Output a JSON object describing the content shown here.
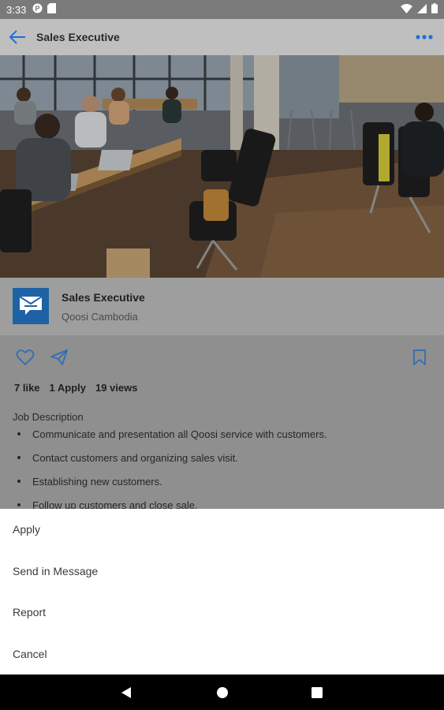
{
  "status_bar": {
    "time": "3:33",
    "icons": [
      "pinterest-icon",
      "sd-card-icon",
      "wifi-icon",
      "signal-icon",
      "battery-icon"
    ]
  },
  "app_bar": {
    "title": "Sales Executive",
    "back_icon": "back-arrow-icon",
    "more_icon": "more-dots-icon",
    "accent": "#1e6fd9"
  },
  "hero": {
    "description": "office coworking space photo"
  },
  "job": {
    "title": "Sales Executive",
    "company": "Qoosi Cambodia",
    "logo_icon": "message-box-icon",
    "logo_color": "#1e62a6"
  },
  "actions": {
    "like_icon": "heart-icon",
    "share_icon": "send-icon",
    "bookmark_icon": "bookmark-icon",
    "color": "#2d6fb5"
  },
  "stats": {
    "likes": "7 like",
    "applies": "1 Apply",
    "views": "19 views"
  },
  "description": {
    "title": "Job Description",
    "bullets": [
      "Communicate and presentation all Qoosi service with customers.",
      "Contact customers and organizing sales visit.",
      "Establishing new customers.",
      "Follow up customers and close sale."
    ]
  },
  "bottom_sheet": {
    "items": [
      "Apply",
      "Send in Message",
      "Report",
      "Cancel"
    ]
  },
  "nav_bar": {
    "icons": [
      "back-triangle-icon",
      "home-circle-icon",
      "recents-square-icon"
    ]
  }
}
